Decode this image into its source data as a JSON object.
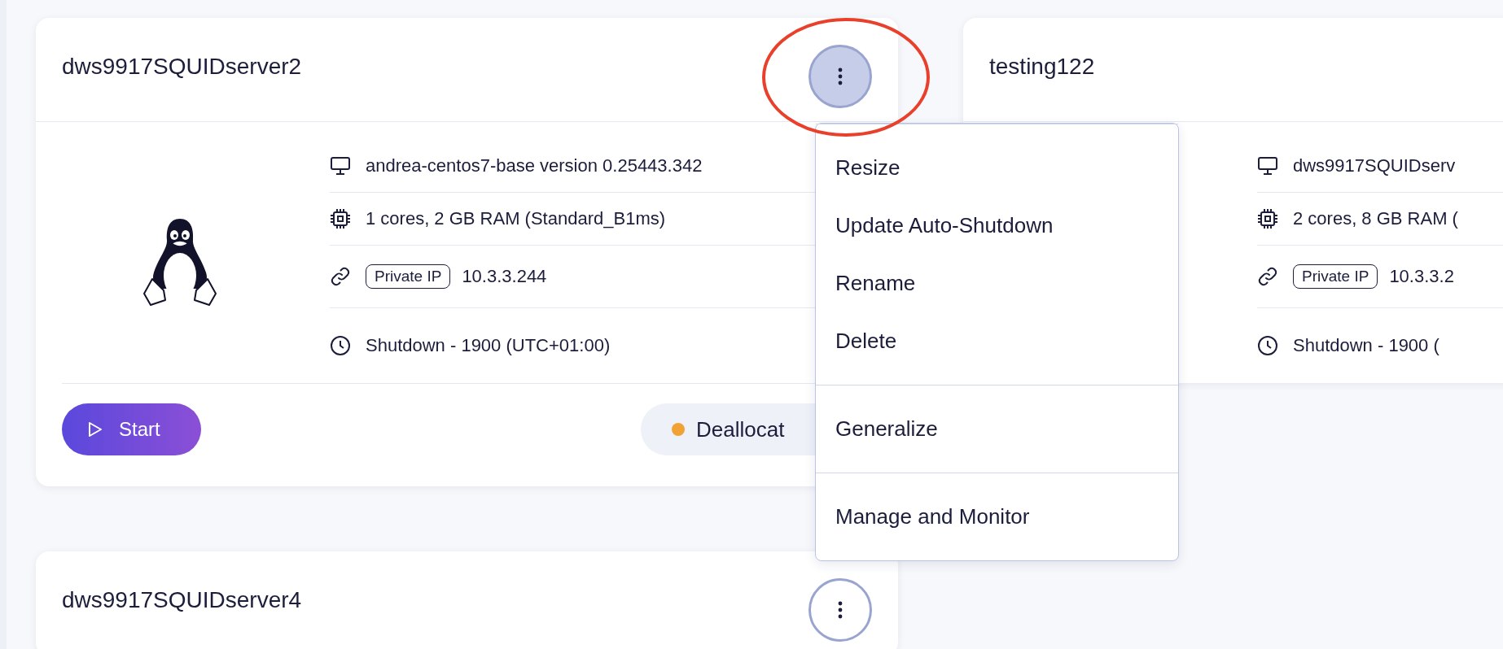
{
  "cards": [
    {
      "title": "dws9917SQUIDserver2",
      "menu_open": true,
      "kind": "linux",
      "details": [
        {
          "kind": "image",
          "text": "andrea-centos7-base version 0.25443.342"
        },
        {
          "kind": "size",
          "text": "1 cores, 2 GB RAM (Standard_B1ms)"
        },
        {
          "kind": "ip",
          "badge": "Private IP",
          "text": "10.3.3.244"
        },
        {
          "kind": "schedule",
          "text": "Shutdown -  1900  (UTC+01:00)"
        }
      ],
      "start_button": "Start",
      "status": "Deallocat"
    },
    {
      "title": "testing122",
      "details": [
        {
          "kind": "image",
          "text": "dws9917SQUIDserv"
        },
        {
          "kind": "size",
          "text": "2 cores, 8 GB RAM ("
        },
        {
          "kind": "ip",
          "badge": "Private IP",
          "text": "10.3.3.2"
        },
        {
          "kind": "schedule",
          "text": "Shutdown -  1900  ("
        }
      ]
    },
    {
      "title": "dws9917SQUIDserver4",
      "menu_open": false
    }
  ],
  "menu": {
    "groups": [
      {
        "items": [
          "Resize",
          "Update Auto-Shutdown",
          "Rename",
          "Delete"
        ]
      },
      {
        "items": [
          "Generalize"
        ]
      },
      {
        "items": [
          "Manage and Monitor"
        ]
      }
    ]
  },
  "highlight": true
}
